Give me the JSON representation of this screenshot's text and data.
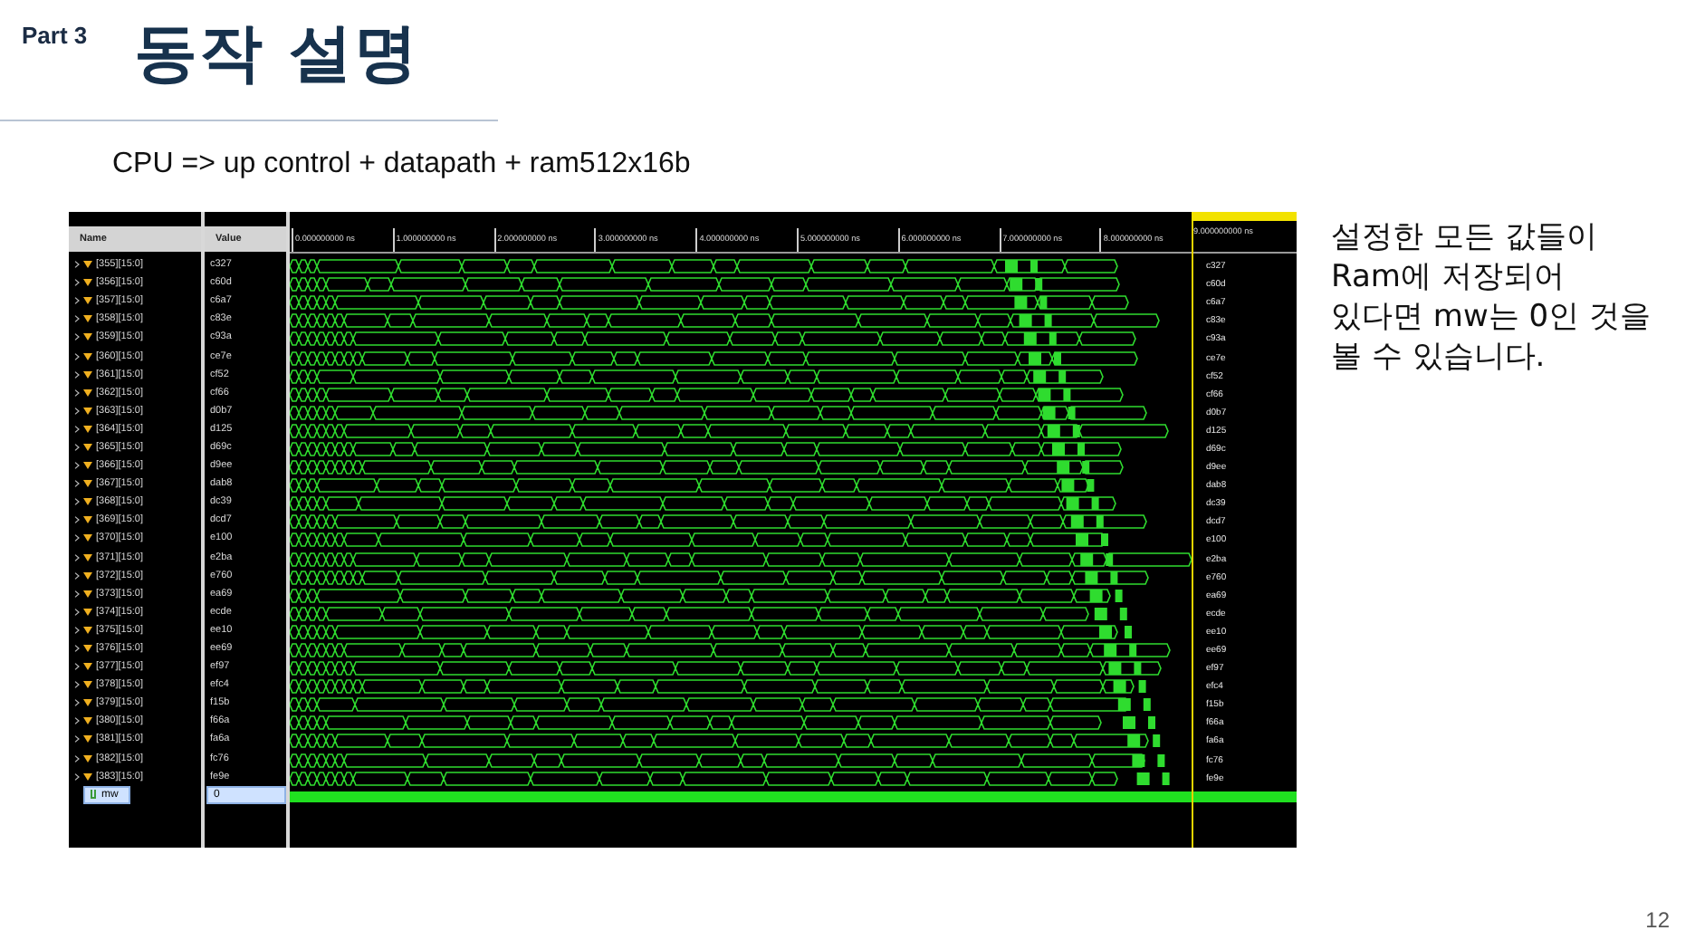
{
  "slide": {
    "part": "Part 3",
    "title": "동작 설명",
    "subtitle": "CPU => up control + datapath + ram512x16b",
    "description": "설정한 모든 값들이 Ram에 저장되어 있다면 mw는 0인  것을 볼 수 있습니다.",
    "page_number": "12"
  },
  "viewer": {
    "columns": [
      "Name",
      "Value"
    ],
    "ruler": [
      "0.000000000 ns",
      "1.000000000 ns",
      "2.000000000 ns",
      "3.000000000 ns",
      "4.000000000 ns",
      "5.000000000 ns",
      "6.000000000 ns",
      "7.000000000 ns",
      "8.000000000 ns"
    ],
    "cursor_label": "9.000000000 ns",
    "signals": [
      {
        "name": "[355][15:0]",
        "value": "c327",
        "wave_value": "c327",
        "kind": "bus",
        "selected": false
      },
      {
        "name": "[356][15:0]",
        "value": "c60d",
        "wave_value": "c60d",
        "kind": "bus",
        "selected": false
      },
      {
        "name": "[357][15:0]",
        "value": "c6a7",
        "wave_value": "c6a7",
        "kind": "bus",
        "selected": false
      },
      {
        "name": "[358][15:0]",
        "value": "c83e",
        "wave_value": "c83e",
        "kind": "bus",
        "selected": false
      },
      {
        "name": "[359][15:0]",
        "value": "c93a",
        "wave_value": "c93a",
        "kind": "bus",
        "selected": false
      },
      {
        "name": "[360][15:0]",
        "value": "ce7e",
        "wave_value": "ce7e",
        "kind": "bus",
        "selected": false
      },
      {
        "name": "[361][15:0]",
        "value": "cf52",
        "wave_value": "cf52",
        "kind": "bus",
        "selected": false
      },
      {
        "name": "[362][15:0]",
        "value": "cf66",
        "wave_value": "cf66",
        "kind": "bus",
        "selected": false
      },
      {
        "name": "[363][15:0]",
        "value": "d0b7",
        "wave_value": "d0b7",
        "kind": "bus",
        "selected": false
      },
      {
        "name": "[364][15:0]",
        "value": "d125",
        "wave_value": "d125",
        "kind": "bus",
        "selected": false
      },
      {
        "name": "[365][15:0]",
        "value": "d69c",
        "wave_value": "d69c",
        "kind": "bus",
        "selected": false
      },
      {
        "name": "[366][15:0]",
        "value": "d9ee",
        "wave_value": "d9ee",
        "kind": "bus",
        "selected": false
      },
      {
        "name": "[367][15:0]",
        "value": "dab8",
        "wave_value": "dab8",
        "kind": "bus",
        "selected": false
      },
      {
        "name": "[368][15:0]",
        "value": "dc39",
        "wave_value": "dc39",
        "kind": "bus",
        "selected": false
      },
      {
        "name": "[369][15:0]",
        "value": "dcd7",
        "wave_value": "dcd7",
        "kind": "bus",
        "selected": false
      },
      {
        "name": "[370][15:0]",
        "value": "e100",
        "wave_value": "e100",
        "kind": "bus",
        "selected": false
      },
      {
        "name": "[371][15:0]",
        "value": "e2ba",
        "wave_value": "e2ba",
        "kind": "bus",
        "selected": false
      },
      {
        "name": "[372][15:0]",
        "value": "e760",
        "wave_value": "e760",
        "kind": "bus",
        "selected": false
      },
      {
        "name": "[373][15:0]",
        "value": "ea69",
        "wave_value": "ea69",
        "kind": "bus",
        "selected": false
      },
      {
        "name": "[374][15:0]",
        "value": "ecde",
        "wave_value": "ecde",
        "kind": "bus",
        "selected": false
      },
      {
        "name": "[375][15:0]",
        "value": "ee10",
        "wave_value": "ee10",
        "kind": "bus",
        "selected": false
      },
      {
        "name": "[376][15:0]",
        "value": "ee69",
        "wave_value": "ee69",
        "kind": "bus",
        "selected": false
      },
      {
        "name": "[377][15:0]",
        "value": "ef97",
        "wave_value": "ef97",
        "kind": "bus",
        "selected": false
      },
      {
        "name": "[378][15:0]",
        "value": "efc4",
        "wave_value": "efc4",
        "kind": "bus",
        "selected": false
      },
      {
        "name": "[379][15:0]",
        "value": "f15b",
        "wave_value": "f15b",
        "kind": "bus",
        "selected": false
      },
      {
        "name": "[380][15:0]",
        "value": "f66a",
        "wave_value": "f66a",
        "kind": "bus",
        "selected": false
      },
      {
        "name": "[381][15:0]",
        "value": "fa6a",
        "wave_value": "fa6a",
        "kind": "bus",
        "selected": false
      },
      {
        "name": "[382][15:0]",
        "value": "fc76",
        "wave_value": "fc76",
        "kind": "bus",
        "selected": false
      },
      {
        "name": "[383][15:0]",
        "value": "fe9e",
        "wave_value": "fe9e",
        "kind": "bus",
        "selected": false
      },
      {
        "name": "mw",
        "value": "0",
        "kind": "bit",
        "selected": true
      }
    ]
  }
}
